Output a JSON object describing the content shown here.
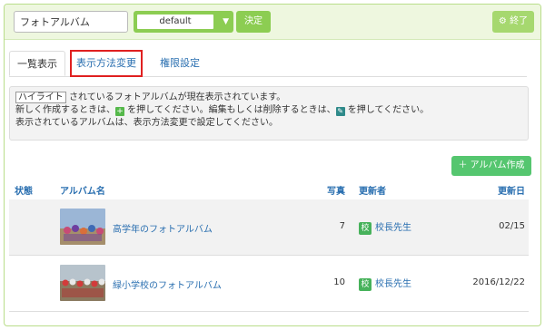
{
  "header": {
    "album_name_value": "フォトアルバム",
    "display_mode_value": "default",
    "decide_label": "決定",
    "finish_label": "終了"
  },
  "tabs": [
    {
      "label": "一覧表示"
    },
    {
      "label": "表示方法変更"
    },
    {
      "label": "権限設定"
    }
  ],
  "info": {
    "highlight_word": "ハイライト",
    "line1_rest": " されているフォトアルバムが現在表示されています。",
    "line2_a": "新しく作成するときは、",
    "line2_b": " を押してください。編集もしくは削除するときは、",
    "line2_c": " を押してください。",
    "line3": "表示されているアルバムは、表示方法変更で設定してください。"
  },
  "create_button_label": "アルバム作成",
  "table": {
    "headers": {
      "status": "状態",
      "album_name": "アルバム名",
      "photos": "写真",
      "updater": "更新者",
      "updated": "更新日"
    },
    "rows": [
      {
        "title": "高学年のフォトアルバム",
        "count": "7",
        "badge": "校",
        "updater": "校長先生",
        "date": "02/15"
      },
      {
        "title": "緑小学校のフォトアルバム",
        "count": "10",
        "badge": "校",
        "updater": "校長先生",
        "date": "2016/12/22"
      }
    ]
  }
}
